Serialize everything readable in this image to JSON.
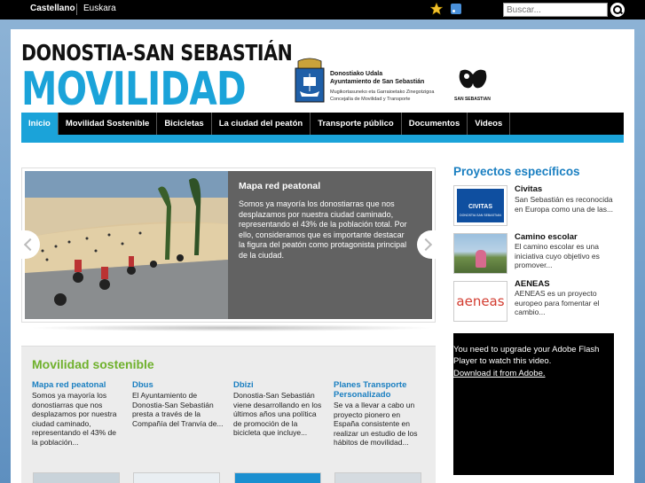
{
  "topbar": {
    "languages": [
      "Castellano",
      "Euskara"
    ],
    "search_placeholder": "Buscar..."
  },
  "header": {
    "logo_line1": "DONOSTIA-SAN SEBASTIÁN",
    "logo_line2": "MOVILIDAD",
    "ayto_line1": "Donostiako Udala",
    "ayto_line2": "Ayuntamiento de San Sebastián",
    "ayto_line3": "Mugikortasuneko eta Garraioetako Zinegotzigoa",
    "ayto_line4": "Concejalía de Movilidad y Transporte",
    "ss_logo_text": "SAN SEBASTIAN"
  },
  "nav": {
    "items": [
      "Inicio",
      "Movilidad Sostenible",
      "Bicicletas",
      "La ciudad del peatón",
      "Transporte público",
      "Documentos",
      "Videos"
    ],
    "active": "Inicio"
  },
  "slider": {
    "title": "Mapa red peatonal",
    "body": "Somos ya mayoría los donostiarras que nos desplazamos por nuestra ciudad caminado, representando el 43% de la población total. Por ello, consideramos que es importante destacar la figura del peatón como protagonista principal de la ciudad."
  },
  "movilidad_sostenible": {
    "title": "Movilidad sostenible",
    "columns": [
      {
        "title": "Mapa red peatonal",
        "body": "Somos ya mayoría los donostiarras que nos desplazamos por nuestra ciudad caminado, representando el 43% de la población..."
      },
      {
        "title": "Dbus",
        "body": "El Ayuntamiento de Donostia-San Sebastián presta a través de la Compañía del Tranvía de..."
      },
      {
        "title": "Dbizi",
        "body": "Donostia-San Sebastián viene desarrollando en los últimos años una política de promoción de la bicicleta que incluye..."
      },
      {
        "title": "Planes Transporte Personalizado",
        "body": "Se va a llevar a cabo un proyecto pionero en España consistente en realizar un estudio de los hábitos de movilidad..."
      }
    ]
  },
  "proyectos": {
    "title": "Proyectos específicos",
    "items": [
      {
        "title": "Civitas",
        "body": "San Sebastián es reconocida en Europa como una de las...",
        "thumb_label": "CIVITAS",
        "thumb_sub": "DONOSTIA SAN SEBASTIAN"
      },
      {
        "title": "Camino escolar",
        "body": "El camino escolar es una iniciativa cuyo objetivo es promover..."
      },
      {
        "title": "AENEAS",
        "body": "AENEAS es un proyecto europeo para fomentar el cambio...",
        "thumb_label": "aeneas"
      }
    ]
  },
  "flash": {
    "message": "You need to upgrade your Adobe Flash Player to watch this video.",
    "link": "Download it from Adobe."
  },
  "colors": {
    "brand_blue": "#1ba3d9",
    "link_blue": "#1a7fc1",
    "green": "#6fb12c"
  }
}
